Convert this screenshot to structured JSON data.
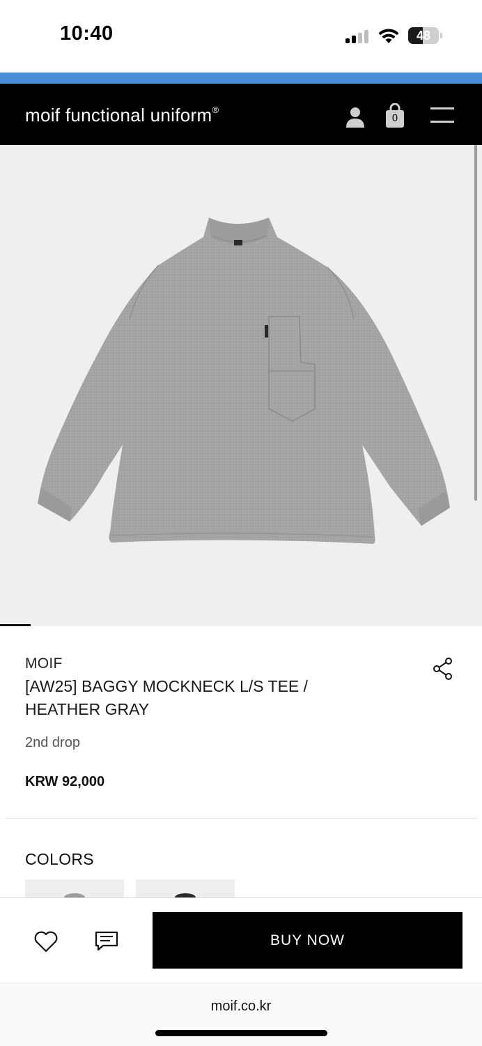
{
  "status_bar": {
    "time": "10:40",
    "battery_level": "48",
    "battery_fraction": 0.48
  },
  "header": {
    "logo_text": "moif functional uniform",
    "logo_mark": "®",
    "cart_count": "0",
    "icons": [
      "user-icon",
      "shopping-bag-icon",
      "menu-icon"
    ]
  },
  "product": {
    "image_alt": "Heather gray baggy mockneck long-sleeve tee with chest pocket",
    "shirt_color": "#a4a4a4",
    "brand": "MOIF",
    "title": "[AW25] BAGGY MOCKNECK L/S TEE / HEATHER GRAY",
    "subtitle": "2nd drop",
    "price": "KRW 92,000"
  },
  "colors": {
    "label": "COLORS",
    "swatches": [
      {
        "color_name": "heather gray",
        "hex": "#9c9c9c"
      },
      {
        "color_name": "black",
        "hex": "#2a2a2a"
      }
    ]
  },
  "actions": {
    "buy_label": "BUY NOW",
    "icons": [
      "heart-icon",
      "review-icon"
    ]
  },
  "browser": {
    "url": "moif.co.kr"
  },
  "colors_theme": {
    "header_bg": "#000000",
    "announce_bar": "#4a90d9",
    "hero_bg": "#efefef"
  }
}
